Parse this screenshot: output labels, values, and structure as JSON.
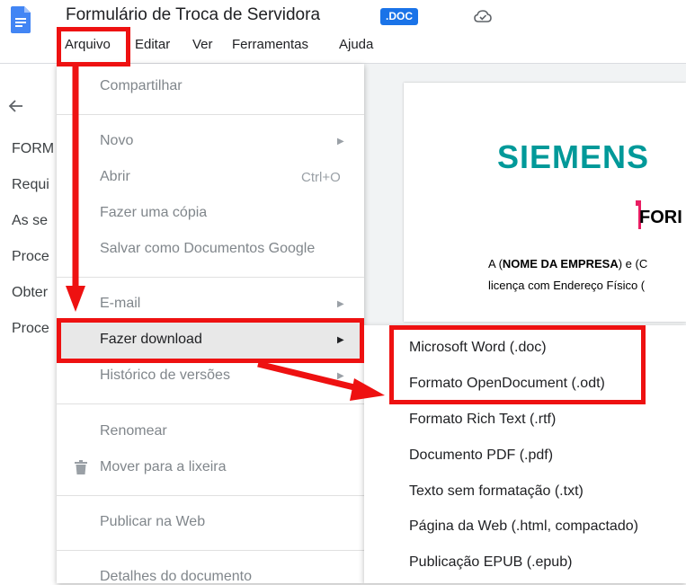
{
  "header": {
    "title": "Formulário de Troca de Servidora",
    "badge": ".DOC",
    "icons": {
      "doc": "google-docs-icon",
      "cloud": "cloud-saved-icon"
    }
  },
  "menubar": {
    "items": [
      "Arquivo",
      "Editar",
      "Ver",
      "Ferramentas",
      "Ajuda"
    ]
  },
  "outline": {
    "items": [
      "FORM",
      "Requi",
      "As se",
      "Proce",
      "Obter",
      "Proce"
    ]
  },
  "document": {
    "logo_text": "SIEMENS",
    "heading_partial": "FORI",
    "para1_prefix": "A (",
    "para1_bold": "NOME DA EMPRESA",
    "para1_suffix": ") e (C",
    "para2": "licença com Endereço Físico ("
  },
  "file_menu": {
    "share": "Compartilhar",
    "new": "Novo",
    "open": "Abrir",
    "open_shortcut": "Ctrl+O",
    "copy": "Fazer uma cópia",
    "save_as_docs": "Salvar como Documentos Google",
    "email": "E-mail",
    "download": "Fazer download",
    "version_history": "Histórico de versões",
    "rename": "Renomear",
    "trash": "Mover para a lixeira",
    "publish": "Publicar na Web",
    "details": "Detalhes do documento"
  },
  "download_submenu": {
    "items": [
      "Microsoft Word (.doc)",
      "Formato OpenDocument (.odt)",
      "Formato Rich Text (.rtf)",
      "Documento PDF (.pdf)",
      "Texto sem formatação (.txt)",
      "Página da Web (.html, compactado)",
      "Publicação EPUB (.epub)"
    ]
  },
  "colors": {
    "accent": "#1a73e8",
    "annotation_red": "#ee1111",
    "logo_teal": "#009999"
  }
}
